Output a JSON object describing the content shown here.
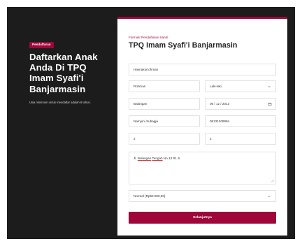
{
  "hero": {
    "badge": "Pendaftaran",
    "title_lines": [
      "Daftarkan Anak",
      "Anda Di TPQ",
      "Imam Syafi'i",
      "Banjarmasin"
    ],
    "note": "Usia minimum untuk mendaftar adalah 6 tahun."
  },
  "form": {
    "subtitle": "Formulir Pendaftaran Santri",
    "title": "TPQ Imam Syafi'i Banjarmasin",
    "full_name": "Hasnakurrohman",
    "nickname": "Rohman",
    "gender": "Laki-laki",
    "birth_place": "Balangan",
    "birth_date": "06 / 12 / 2013",
    "parent_name": "Namjuni Subagja",
    "phone": "08131209994",
    "field_a": "2",
    "field_b": "2",
    "address_parts": [
      "Jl. ",
      "Balangan",
      " ",
      "Tengah",
      " No.13 Rt. 6"
    ],
    "program": "Normal (Rp50.000,00)",
    "submit_label": "Selanjutnya"
  },
  "colors": {
    "accent": "#a0063a",
    "background": "#1c1c1c"
  },
  "icons": {
    "select": "chevron-down-icon",
    "date": "calendar-icon"
  }
}
